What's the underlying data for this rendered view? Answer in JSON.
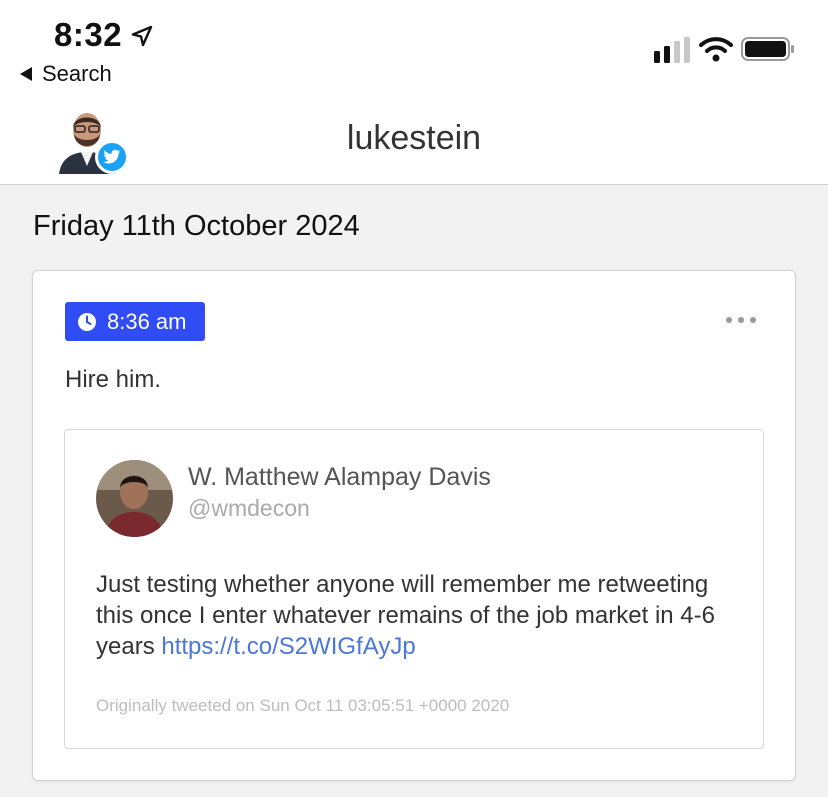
{
  "status_bar": {
    "time": "8:32",
    "back_label": "Search"
  },
  "nav": {
    "title": "lukestein"
  },
  "date_heading": "Friday 11th October 2024",
  "post": {
    "time_badge": "8:36 am",
    "text": "Hire him.",
    "quoted_tweet": {
      "author_name": "W. Matthew Alampay Davis",
      "handle": "@wmdecon",
      "body": "Just testing whether anyone will remember me retweeting this once I enter whatever remains of the job market in 4-6 years",
      "link": "https://t.co/S2WIGfAyJp",
      "footer": "Originally tweeted on Sun Oct 11 03:05:51 +0000 2020"
    }
  },
  "colors": {
    "accent": "#2f4cf5",
    "twitter": "#1da1f2",
    "link": "#4a77d8"
  },
  "icons": [
    "location-arrow-icon",
    "back-arrow-icon",
    "cellular-signal-icon",
    "wifi-icon",
    "battery-icon",
    "twitter-bird-icon",
    "clock-icon",
    "more-options-icon"
  ]
}
